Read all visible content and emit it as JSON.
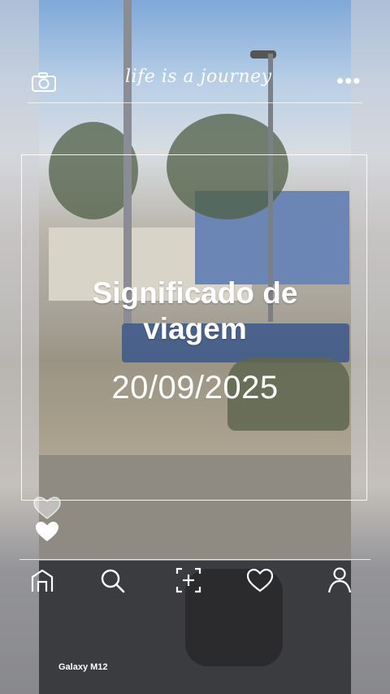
{
  "overlay": {
    "tagline": "life is a journey",
    "title_line1": "Significado de",
    "title_line2": "viagem",
    "date": "20/09/2025",
    "device_label": "Galaxy M12"
  },
  "icons": {
    "top_left": "camera-icon",
    "top_right": "more-icon",
    "hearts": [
      "heart-outline-icon",
      "heart-filled-icon"
    ],
    "bottom_nav": [
      "home-icon",
      "search-icon",
      "add-icon",
      "heart-icon",
      "profile-icon"
    ]
  },
  "colors": {
    "overlay_text": "#ffffff"
  }
}
